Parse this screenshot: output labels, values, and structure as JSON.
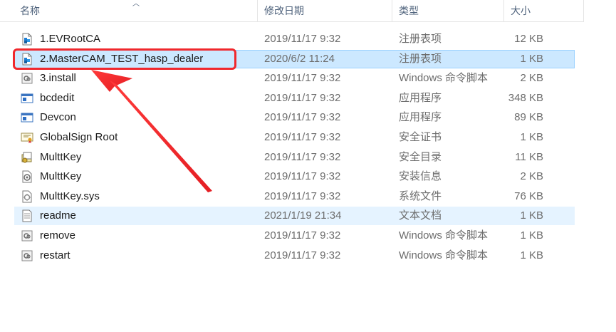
{
  "columns": {
    "name": "名称",
    "date": "修改日期",
    "type": "类型",
    "size": "大小"
  },
  "files": [
    {
      "name": "1.EVRootCA",
      "date": "2019/11/17 9:32",
      "type": "注册表项",
      "size": "12 KB",
      "icon": "registry-icon"
    },
    {
      "name": "2.MasterCAM_TEST_hasp_dealer",
      "date": "2020/6/2 11:24",
      "type": "注册表项",
      "size": "1 KB",
      "icon": "registry-icon"
    },
    {
      "name": "3.install",
      "date": "2019/11/17 9:32",
      "type": "Windows 命令脚本",
      "size": "2 KB",
      "icon": "script-icon"
    },
    {
      "name": "bcdedit",
      "date": "2019/11/17 9:32",
      "type": "应用程序",
      "size": "348 KB",
      "icon": "application-icon"
    },
    {
      "name": "Devcon",
      "date": "2019/11/17 9:32",
      "type": "应用程序",
      "size": "89 KB",
      "icon": "application-icon"
    },
    {
      "name": "GlobalSign Root",
      "date": "2019/11/17 9:32",
      "type": "安全证书",
      "size": "1 KB",
      "icon": "certificate-icon"
    },
    {
      "name": "MulttKey",
      "date": "2019/11/17 9:32",
      "type": "安全目录",
      "size": "11 KB",
      "icon": "security-catalog-icon"
    },
    {
      "name": "MulttKey",
      "date": "2019/11/17 9:32",
      "type": "安装信息",
      "size": "2 KB",
      "icon": "setup-info-icon"
    },
    {
      "name": "MulttKey.sys",
      "date": "2019/11/17 9:32",
      "type": "系统文件",
      "size": "76 KB",
      "icon": "system-file-icon"
    },
    {
      "name": "readme",
      "date": "2021/1/19 21:34",
      "type": "文本文档",
      "size": "1 KB",
      "icon": "text-file-icon"
    },
    {
      "name": "remove",
      "date": "2019/11/17 9:32",
      "type": "Windows 命令脚本",
      "size": "1 KB",
      "icon": "script-icon"
    },
    {
      "name": "restart",
      "date": "2019/11/17 9:32",
      "type": "Windows 命令脚本",
      "size": "1 KB",
      "icon": "script-icon"
    }
  ],
  "selected_row": 1,
  "hover_row": 9,
  "colors": {
    "annotation": "#f0282d",
    "selection": "#cce8ff",
    "hover": "#e5f3ff"
  }
}
